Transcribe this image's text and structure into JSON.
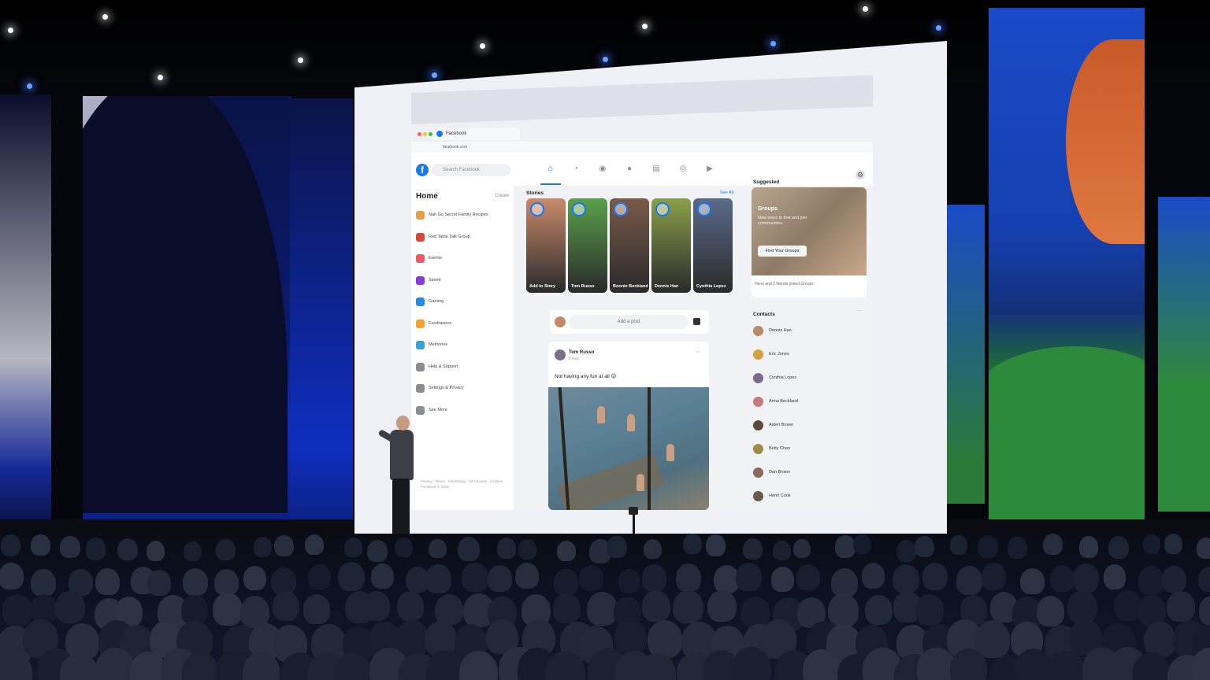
{
  "browser": {
    "tab_title": "Facebook",
    "url": "facebook.com",
    "colors": {
      "fb_blue": "#1877f2",
      "bg": "#f0f2f5"
    }
  },
  "topbar": {
    "logo": "f",
    "search_placeholder": "Search Facebook",
    "nav_icons": [
      "home-icon",
      "bell-icon",
      "messenger-icon",
      "profile-icon",
      "marketplace-icon",
      "groups-icon",
      "watch-icon"
    ]
  },
  "leftnav": {
    "title": "Home",
    "create_label": "Create",
    "items": [
      {
        "label": "Nah Go Secret Family Recipes",
        "color": "#e4a14a"
      },
      {
        "label": "Red Table Talk Group",
        "color": "#d44a3a"
      },
      {
        "label": "Events",
        "color": "#e85c6a"
      },
      {
        "label": "Saved",
        "color": "#8a3ae0"
      },
      {
        "label": "Gaming",
        "color": "#2a8ae0"
      },
      {
        "label": "Fundraisers",
        "color": "#f0a030"
      },
      {
        "label": "Memories",
        "color": "#3aa0d8"
      },
      {
        "label": "Help & Support",
        "color": "#8a8d91"
      },
      {
        "label": "Settings & Privacy",
        "color": "#8a8d91"
      },
      {
        "label": "See More",
        "color": "#8a8d91"
      }
    ],
    "footer": "Privacy · Terms · Advertising · Ad Choices · Cookies · Facebook © 2019"
  },
  "stories": {
    "heading": "Stories",
    "see_all": "See All",
    "items": [
      {
        "name": "Add to Story",
        "bg": "#c98a6a"
      },
      {
        "name": "Tom Russo",
        "bg": "#5aa04a"
      },
      {
        "name": "Bonnie Beckland",
        "bg": "#7a5a4a"
      },
      {
        "name": "Dennis Han",
        "bg": "#8aa04a"
      },
      {
        "name": "Cynthia Lopez",
        "bg": "#5a6a8a"
      }
    ]
  },
  "composer": {
    "placeholder": "Add a post"
  },
  "post": {
    "author": "Tom Russo",
    "time": "3 mins",
    "text": "Not having any fun at all 😜"
  },
  "suggested": {
    "heading": "Suggested",
    "groups_label": "Groups",
    "groups_desc": "New ways to find and join communities.",
    "button": "Find Your Groups",
    "joined_text": "Henri and 2 friends joined Groups"
  },
  "contacts": {
    "heading": "Contacts",
    "items": [
      {
        "name": "Dennis Han",
        "color": "#b88a6a"
      },
      {
        "name": "Eric Jones",
        "color": "#d4a040"
      },
      {
        "name": "Cynthia Lopez",
        "color": "#7a6a8a"
      },
      {
        "name": "Anna Beckland",
        "color": "#c47a7a"
      },
      {
        "name": "Aiden Brown",
        "color": "#5a4a3a"
      },
      {
        "name": "Betty Chen",
        "color": "#a08a4a"
      },
      {
        "name": "Dan Brown",
        "color": "#8a6a5a"
      },
      {
        "name": "Henri Cook",
        "color": "#6a5a4a"
      }
    ]
  }
}
